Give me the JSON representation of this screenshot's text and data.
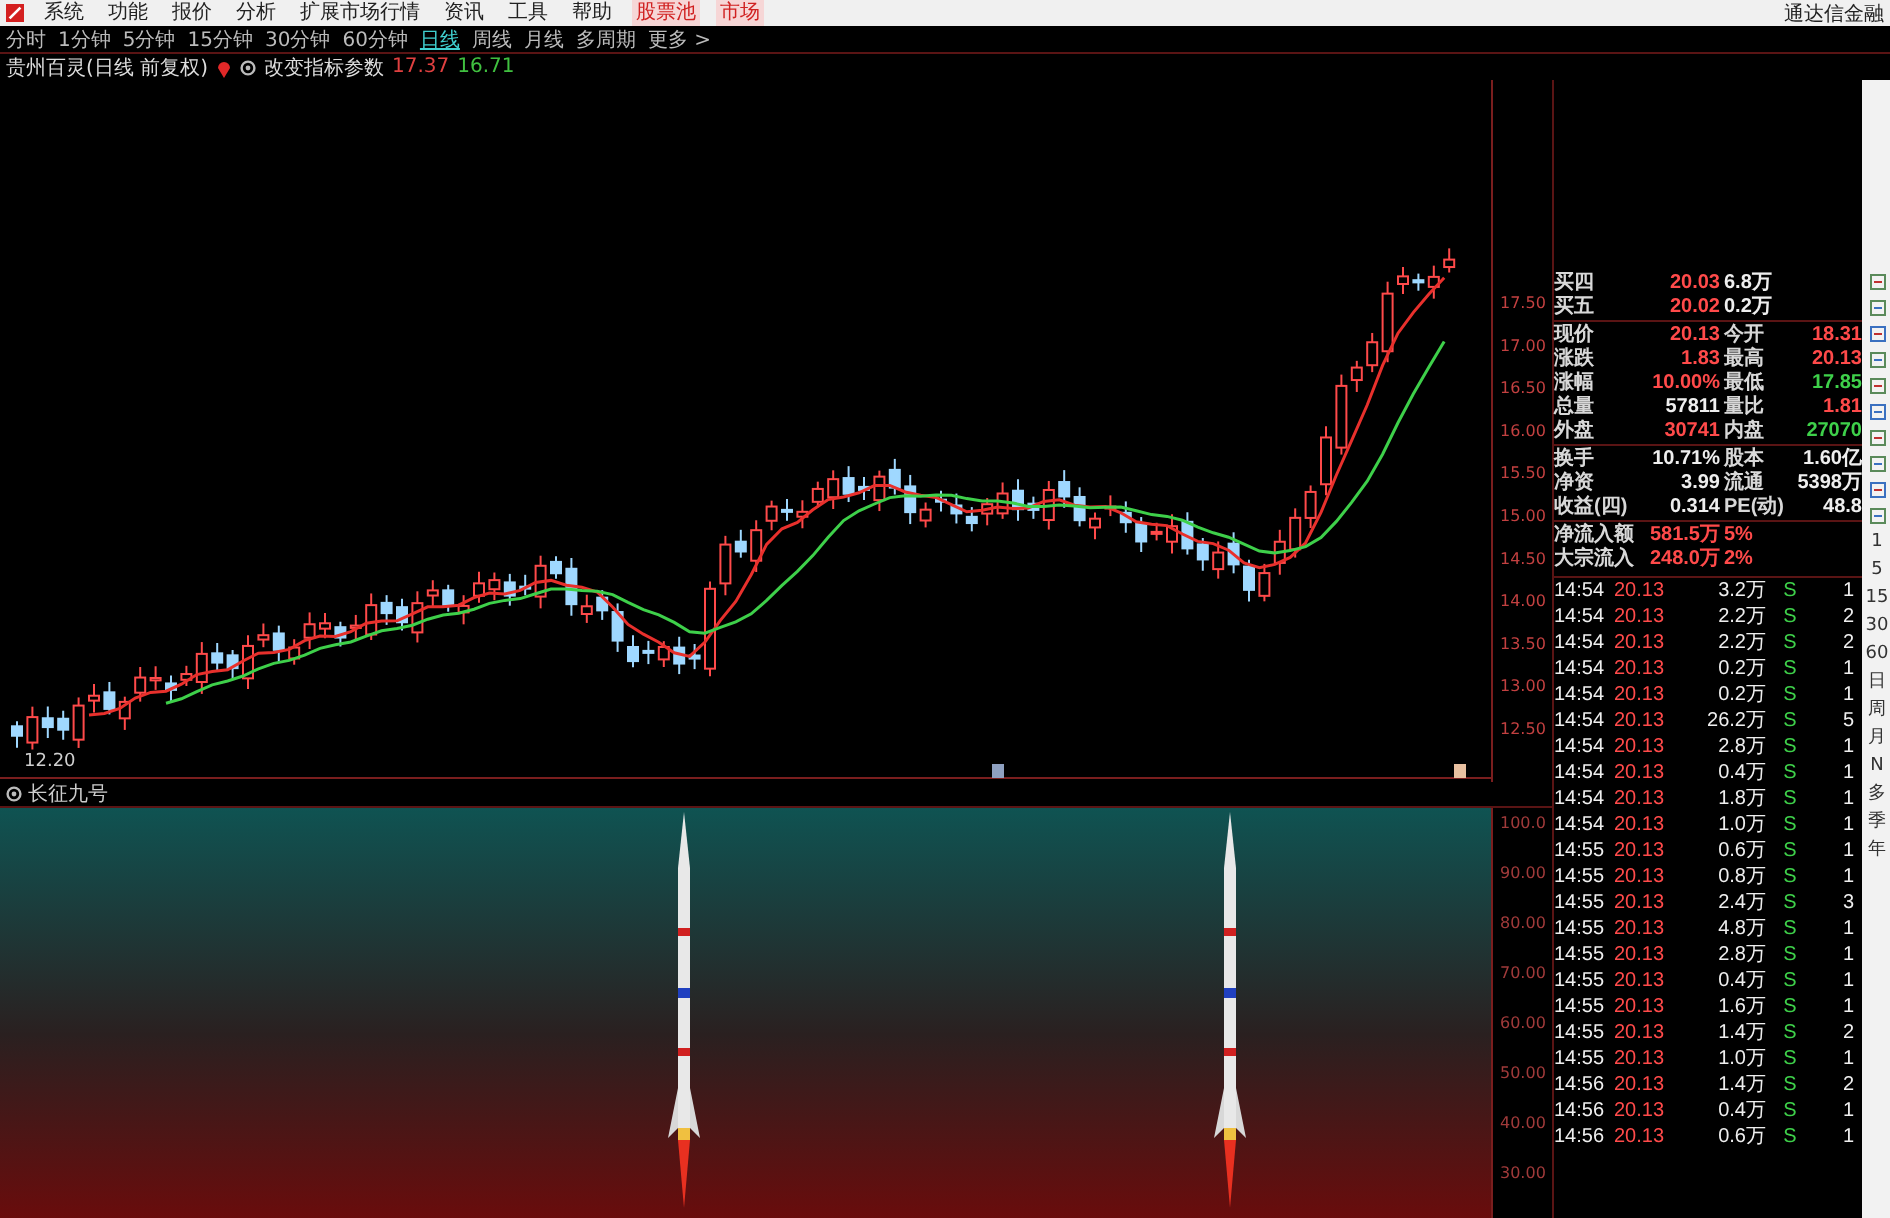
{
  "menu": [
    {
      "label": "系统",
      "highlighted": false
    },
    {
      "label": "功能",
      "highlighted": false
    },
    {
      "label": "报价",
      "highlighted": false
    },
    {
      "label": "分析",
      "highlighted": false
    },
    {
      "label": "扩展市场行情",
      "highlighted": false
    },
    {
      "label": "资讯",
      "highlighted": false
    },
    {
      "label": "工具",
      "highlighted": false
    },
    {
      "label": "帮助",
      "highlighted": false
    },
    {
      "label": "股票池",
      "highlighted": true
    },
    {
      "label": "市场",
      "highlighted": true
    }
  ],
  "app_title": "通达信金融",
  "periods": [
    {
      "label": "分时",
      "selected": false
    },
    {
      "label": "1分钟",
      "selected": false
    },
    {
      "label": "5分钟",
      "selected": false
    },
    {
      "label": "15分钟",
      "selected": false
    },
    {
      "label": "30分钟",
      "selected": false
    },
    {
      "label": "60分钟",
      "selected": false
    },
    {
      "label": "日线",
      "selected": true
    },
    {
      "label": "周线",
      "selected": false
    },
    {
      "label": "月线",
      "selected": false
    },
    {
      "label": "多周期",
      "selected": false
    },
    {
      "label": "更多 >",
      "selected": false
    }
  ],
  "chart_header": {
    "title": "贵州百灵(日线 前复权)",
    "indicator": "改变指标参数",
    "value_1": "17.37",
    "value_2": "16.71"
  },
  "price_axis": [
    "17.50",
    "17.00",
    "16.50",
    "16.00",
    "15.50",
    "15.00",
    "14.50",
    "14.00",
    "13.50",
    "13.00",
    "12.50"
  ],
  "low_label": "12.20",
  "indicator_panel": {
    "title": "长征九号",
    "axis": [
      "100.0",
      "90.00",
      "80.00",
      "70.00",
      "60.00",
      "50.00",
      "40.00",
      "30.00"
    ]
  },
  "quote_rows": [
    {
      "cells": [
        {
          "text": "买四",
          "kind": "label"
        },
        {
          "text": "20.03",
          "kind": "up"
        },
        {
          "text": "6.8万",
          "kind": "plain"
        }
      ]
    },
    {
      "cells": [
        {
          "text": "买五",
          "kind": "label"
        },
        {
          "text": "20.02",
          "kind": "up"
        },
        {
          "text": "0.2万",
          "kind": "plain"
        }
      ]
    },
    {
      "cells": [
        {
          "text": "现价",
          "kind": "label"
        },
        {
          "text": "20.13",
          "kind": "up"
        },
        {
          "text": "今开",
          "kind": "label"
        },
        {
          "text": "18.31",
          "kind": "up"
        }
      ]
    },
    {
      "cells": [
        {
          "text": "涨跌",
          "kind": "label"
        },
        {
          "text": "1.83",
          "kind": "up"
        },
        {
          "text": "最高",
          "kind": "label"
        },
        {
          "text": "20.13",
          "kind": "up"
        }
      ]
    },
    {
      "cells": [
        {
          "text": "涨幅",
          "kind": "label"
        },
        {
          "text": "10.00%",
          "kind": "up"
        },
        {
          "text": "最低",
          "kind": "label"
        },
        {
          "text": "17.85",
          "kind": "down"
        }
      ]
    },
    {
      "cells": [
        {
          "text": "总量",
          "kind": "label"
        },
        {
          "text": "57811",
          "kind": "plain"
        },
        {
          "text": "量比",
          "kind": "label"
        },
        {
          "text": "1.81",
          "kind": "up"
        }
      ]
    },
    {
      "cells": [
        {
          "text": "外盘",
          "kind": "label"
        },
        {
          "text": "30741",
          "kind": "up"
        },
        {
          "text": "内盘",
          "kind": "label"
        },
        {
          "text": "27070",
          "kind": "down"
        }
      ]
    },
    {
      "cells": [
        {
          "text": "换手",
          "kind": "label"
        },
        {
          "text": "10.71%",
          "kind": "plain"
        },
        {
          "text": "股本",
          "kind": "label"
        },
        {
          "text": "1.60亿",
          "kind": "plain"
        }
      ]
    },
    {
      "cells": [
        {
          "text": "净资",
          "kind": "label"
        },
        {
          "text": "3.99",
          "kind": "plain"
        },
        {
          "text": "流通",
          "kind": "label"
        },
        {
          "text": "5398万",
          "kind": "plain"
        }
      ]
    },
    {
      "cells": [
        {
          "text": "收益(四)",
          "kind": "label"
        },
        {
          "text": "0.314",
          "kind": "plain"
        },
        {
          "text": "PE(动)",
          "kind": "label"
        },
        {
          "text": "48.8",
          "kind": "plain"
        }
      ]
    },
    {
      "cells": [
        {
          "text": "净流入额",
          "kind": "label"
        },
        {
          "text": "581.5万",
          "kind": "up"
        },
        {
          "text": "5%",
          "kind": "up"
        }
      ]
    },
    {
      "cells": [
        {
          "text": "大宗流入",
          "kind": "label"
        },
        {
          "text": "248.0万",
          "kind": "up"
        },
        {
          "text": "2%",
          "kind": "up"
        }
      ]
    }
  ],
  "trades": [
    {
      "time": "14:54",
      "price": "20.13",
      "volume": "3.2万",
      "side": "S",
      "count": "1"
    },
    {
      "time": "14:54",
      "price": "20.13",
      "volume": "2.2万",
      "side": "S",
      "count": "2"
    },
    {
      "time": "14:54",
      "price": "20.13",
      "volume": "2.2万",
      "side": "S",
      "count": "2"
    },
    {
      "time": "14:54",
      "price": "20.13",
      "volume": "0.2万",
      "side": "S",
      "count": "1"
    },
    {
      "time": "14:54",
      "price": "20.13",
      "volume": "0.2万",
      "side": "S",
      "count": "1"
    },
    {
      "time": "14:54",
      "price": "20.13",
      "volume": "26.2万",
      "side": "S",
      "count": "5"
    },
    {
      "time": "14:54",
      "price": "20.13",
      "volume": "2.8万",
      "side": "S",
      "count": "1"
    },
    {
      "time": "14:54",
      "price": "20.13",
      "volume": "0.4万",
      "side": "S",
      "count": "1"
    },
    {
      "time": "14:54",
      "price": "20.13",
      "volume": "1.8万",
      "side": "S",
      "count": "1"
    },
    {
      "time": "14:54",
      "price": "20.13",
      "volume": "1.0万",
      "side": "S",
      "count": "1"
    },
    {
      "time": "14:55",
      "price": "20.13",
      "volume": "0.6万",
      "side": "S",
      "count": "1"
    },
    {
      "time": "14:55",
      "price": "20.13",
      "volume": "0.8万",
      "side": "S",
      "count": "1"
    },
    {
      "time": "14:55",
      "price": "20.13",
      "volume": "2.4万",
      "side": "S",
      "count": "3"
    },
    {
      "time": "14:55",
      "price": "20.13",
      "volume": "4.8万",
      "side": "S",
      "count": "1"
    },
    {
      "time": "14:55",
      "price": "20.13",
      "volume": "2.8万",
      "side": "S",
      "count": "1"
    },
    {
      "time": "14:55",
      "price": "20.13",
      "volume": "0.4万",
      "side": "S",
      "count": "1"
    },
    {
      "time": "14:55",
      "price": "20.13",
      "volume": "1.6万",
      "side": "S",
      "count": "1"
    },
    {
      "time": "14:55",
      "price": "20.13",
      "volume": "1.4万",
      "side": "S",
      "count": "2"
    },
    {
      "time": "14:55",
      "price": "20.13",
      "volume": "1.0万",
      "side": "S",
      "count": "1"
    },
    {
      "time": "14:56",
      "price": "20.13",
      "volume": "1.4万",
      "side": "S",
      "count": "2"
    },
    {
      "time": "14:56",
      "price": "20.13",
      "volume": "0.4万",
      "side": "S",
      "count": "1"
    },
    {
      "time": "14:56",
      "price": "20.13",
      "volume": "0.6万",
      "side": "S",
      "count": "1"
    }
  ],
  "toolbar_labels": [
    "1",
    "5",
    "15",
    "30",
    "60",
    "日",
    "周",
    "月",
    "N",
    "多",
    "季",
    "年"
  ]
}
